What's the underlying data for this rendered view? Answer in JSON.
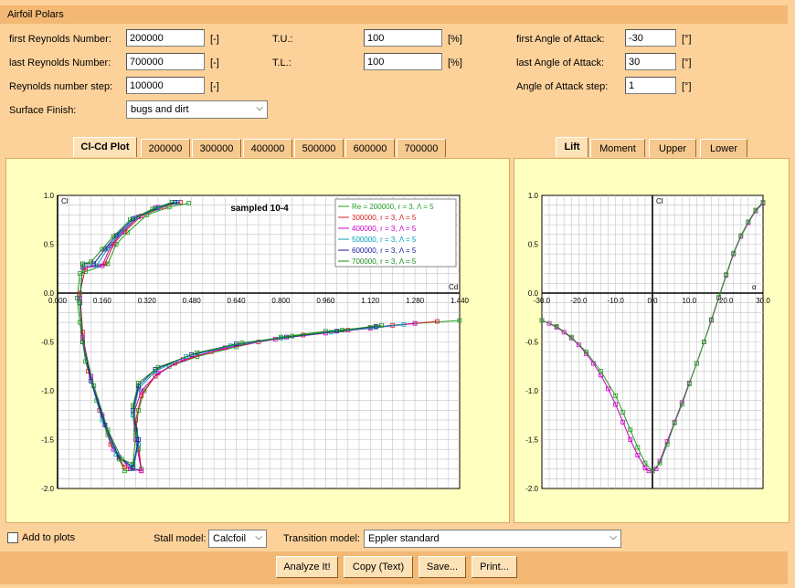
{
  "window": {
    "title": "Airfoil Polars"
  },
  "form": {
    "first_re": {
      "label": "first Reynolds Number:",
      "value": "200000",
      "unit": "[-]"
    },
    "last_re": {
      "label": "last Reynolds Number:",
      "value": "700000",
      "unit": "[-]"
    },
    "re_step": {
      "label": "Reynolds number step:",
      "value": "100000",
      "unit": "[-]"
    },
    "surface": {
      "label": "Surface Finish:",
      "value": "bugs and dirt"
    },
    "tu": {
      "label": "T.U.:",
      "value": "100",
      "unit": "[%]"
    },
    "tl": {
      "label": "T.L.:",
      "value": "100",
      "unit": "[%]"
    },
    "first_aoa": {
      "label": "first Angle of Attack:",
      "value": "-30",
      "unit": "[°]"
    },
    "last_aoa": {
      "label": "last Angle of Attack:",
      "value": "30",
      "unit": "[°]"
    },
    "aoa_step": {
      "label": "Angle of Attack step:",
      "value": "1",
      "unit": "[°]"
    }
  },
  "left_tabs": [
    "Cl-Cd Plot",
    "200000",
    "300000",
    "400000",
    "500000",
    "600000",
    "700000"
  ],
  "right_tabs": [
    "Lift",
    "Moment",
    "Upper",
    "Lower"
  ],
  "chart_data": [
    {
      "type": "line",
      "title": "sampled 10-4",
      "xlabel": "Cd",
      "ylabel": "Cl",
      "xlim": [
        0.0,
        1.44
      ],
      "ylim": [
        -2.0,
        1.0
      ],
      "x_ticks": [
        "0.000",
        "0.160",
        "0.320",
        "0.480",
        "0.640",
        "0.800",
        "0.960",
        "1.120",
        "1.280",
        "1.440"
      ],
      "y_ticks": [
        "1.0",
        "0.5",
        "0.0",
        "-0.5",
        "-1.0",
        "-1.5",
        "-2.0"
      ],
      "legend_position": "top-right",
      "series": [
        {
          "name": "Re = 200000, r = 3, Λ = 5",
          "color": "#1f9d1f",
          "points": [
            [
              0.47,
              0.92
            ],
            [
              0.4,
              0.88
            ],
            [
              0.32,
              0.8
            ],
            [
              0.25,
              0.62
            ],
            [
              0.21,
              0.5
            ],
            [
              0.18,
              0.3
            ],
            [
              0.1,
              0.22
            ],
            [
              0.08,
              0.2
            ],
            [
              0.07,
              -0.05
            ],
            [
              0.08,
              -0.3
            ],
            [
              0.1,
              -0.7
            ],
            [
              0.14,
              -1.1
            ],
            [
              0.18,
              -1.45
            ],
            [
              0.22,
              -1.7
            ],
            [
              0.24,
              -1.82
            ],
            [
              0.3,
              -1.8
            ],
            [
              0.29,
              -1.6
            ],
            [
              0.28,
              -1.4
            ],
            [
              0.29,
              -1.2
            ],
            [
              0.31,
              -1.0
            ],
            [
              0.35,
              -0.85
            ],
            [
              0.4,
              -0.75
            ],
            [
              0.5,
              -0.65
            ],
            [
              0.64,
              -0.55
            ],
            [
              0.8,
              -0.45
            ],
            [
              0.96,
              -0.39
            ],
            [
              1.12,
              -0.35
            ],
            [
              1.28,
              -0.31
            ],
            [
              1.44,
              -0.28
            ]
          ]
        },
        {
          "name": "300000, r = 3, Λ = 5",
          "color": "#d42020",
          "points": [
            [
              0.44,
              0.93
            ],
            [
              0.38,
              0.88
            ],
            [
              0.3,
              0.79
            ],
            [
              0.24,
              0.63
            ],
            [
              0.2,
              0.5
            ],
            [
              0.17,
              0.3
            ],
            [
              0.1,
              0.26
            ],
            [
              0.08,
              0.0
            ],
            [
              0.09,
              -0.4
            ],
            [
              0.11,
              -0.8
            ],
            [
              0.15,
              -1.2
            ],
            [
              0.19,
              -1.55
            ],
            [
              0.24,
              -1.78
            ],
            [
              0.3,
              -1.82
            ],
            [
              0.29,
              -1.55
            ],
            [
              0.28,
              -1.3
            ],
            [
              0.3,
              -1.05
            ],
            [
              0.35,
              -0.85
            ],
            [
              0.42,
              -0.72
            ],
            [
              0.55,
              -0.6
            ],
            [
              0.72,
              -0.5
            ],
            [
              0.88,
              -0.43
            ],
            [
              1.04,
              -0.38
            ],
            [
              1.2,
              -0.33
            ],
            [
              1.36,
              -0.29
            ]
          ]
        },
        {
          "name": "400000, r = 3, Λ = 5",
          "color": "#c800c8",
          "points": [
            [
              0.43,
              0.93
            ],
            [
              0.36,
              0.88
            ],
            [
              0.29,
              0.78
            ],
            [
              0.23,
              0.62
            ],
            [
              0.19,
              0.48
            ],
            [
              0.16,
              0.28
            ],
            [
              0.09,
              0.26
            ],
            [
              0.08,
              -0.05
            ],
            [
              0.09,
              -0.45
            ],
            [
              0.12,
              -0.85
            ],
            [
              0.16,
              -1.25
            ],
            [
              0.2,
              -1.6
            ],
            [
              0.26,
              -1.8
            ],
            [
              0.3,
              -1.82
            ],
            [
              0.28,
              -1.5
            ],
            [
              0.27,
              -1.25
            ],
            [
              0.3,
              -1.0
            ],
            [
              0.36,
              -0.82
            ],
            [
              0.45,
              -0.68
            ],
            [
              0.6,
              -0.56
            ],
            [
              0.78,
              -0.47
            ],
            [
              0.96,
              -0.41
            ],
            [
              1.12,
              -0.36
            ],
            [
              1.28,
              -0.31
            ]
          ]
        },
        {
          "name": "500000, r = 3, Λ = 5",
          "color": "#00a0b0",
          "points": [
            [
              0.43,
              0.93
            ],
            [
              0.36,
              0.87
            ],
            [
              0.28,
              0.77
            ],
            [
              0.22,
              0.6
            ],
            [
              0.18,
              0.46
            ],
            [
              0.14,
              0.28
            ],
            [
              0.09,
              0.28
            ],
            [
              0.08,
              -0.1
            ],
            [
              0.09,
              -0.5
            ],
            [
              0.12,
              -0.9
            ],
            [
              0.16,
              -1.3
            ],
            [
              0.21,
              -1.65
            ],
            [
              0.27,
              -1.8
            ],
            [
              0.29,
              -1.55
            ],
            [
              0.27,
              -1.25
            ],
            [
              0.29,
              -0.98
            ],
            [
              0.35,
              -0.8
            ],
            [
              0.46,
              -0.65
            ],
            [
              0.62,
              -0.54
            ],
            [
              0.8,
              -0.46
            ],
            [
              0.98,
              -0.4
            ],
            [
              1.14,
              -0.35
            ],
            [
              1.24,
              -0.32
            ]
          ]
        },
        {
          "name": "600000, r = 3, Λ = 5",
          "color": "#1a1aa0",
          "points": [
            [
              0.42,
              0.93
            ],
            [
              0.35,
              0.87
            ],
            [
              0.27,
              0.76
            ],
            [
              0.21,
              0.59
            ],
            [
              0.17,
              0.45
            ],
            [
              0.13,
              0.3
            ],
            [
              0.09,
              0.3
            ],
            [
              0.08,
              -0.1
            ],
            [
              0.09,
              -0.5
            ],
            [
              0.12,
              -0.9
            ],
            [
              0.17,
              -1.35
            ],
            [
              0.22,
              -1.68
            ],
            [
              0.27,
              -1.78
            ],
            [
              0.29,
              -1.5
            ],
            [
              0.27,
              -1.2
            ],
            [
              0.29,
              -0.95
            ],
            [
              0.35,
              -0.78
            ],
            [
              0.48,
              -0.63
            ],
            [
              0.64,
              -0.52
            ],
            [
              0.82,
              -0.45
            ],
            [
              1.0,
              -0.39
            ],
            [
              1.14,
              -0.34
            ]
          ]
        },
        {
          "name": "700000, r = 3, Λ = 5",
          "color": "#1a8a1a",
          "points": [
            [
              0.41,
              0.93
            ],
            [
              0.34,
              0.86
            ],
            [
              0.26,
              0.75
            ],
            [
              0.2,
              0.58
            ],
            [
              0.16,
              0.45
            ],
            [
              0.12,
              0.32
            ],
            [
              0.09,
              0.3
            ],
            [
              0.08,
              -0.1
            ],
            [
              0.09,
              -0.5
            ],
            [
              0.13,
              -0.95
            ],
            [
              0.18,
              -1.4
            ],
            [
              0.23,
              -1.7
            ],
            [
              0.27,
              -1.75
            ],
            [
              0.28,
              -1.45
            ],
            [
              0.27,
              -1.15
            ],
            [
              0.29,
              -0.92
            ],
            [
              0.36,
              -0.76
            ],
            [
              0.5,
              -0.61
            ],
            [
              0.66,
              -0.51
            ],
            [
              0.84,
              -0.44
            ],
            [
              1.02,
              -0.38
            ],
            [
              1.16,
              -0.33
            ]
          ]
        }
      ]
    },
    {
      "type": "line",
      "xlabel": "α",
      "ylabel": "Cl",
      "xlim": [
        -30,
        30
      ],
      "ylim": [
        -2.0,
        1.0
      ],
      "x_ticks": [
        "-30.0",
        "-20.0",
        "-10.0",
        "0.0",
        "10.0",
        "20.0",
        "30.0"
      ],
      "y_ticks": [
        "1.0",
        "0.5",
        "0.0",
        "-0.5",
        "-1.0",
        "-1.5",
        "-2.0"
      ],
      "series": [
        {
          "color": "#c800c8",
          "points": [
            [
              -30,
              -0.28
            ],
            [
              -28,
              -0.31
            ],
            [
              -26,
              -0.35
            ],
            [
              -24,
              -0.4
            ],
            [
              -22,
              -0.46
            ],
            [
              -20,
              -0.53
            ],
            [
              -18,
              -0.62
            ],
            [
              -16,
              -0.72
            ],
            [
              -14,
              -0.84
            ],
            [
              -12,
              -0.98
            ],
            [
              -10,
              -1.14
            ],
            [
              -8,
              -1.32
            ],
            [
              -6,
              -1.5
            ],
            [
              -4,
              -1.66
            ],
            [
              -2,
              -1.79
            ],
            [
              -1,
              -1.82
            ],
            [
              0,
              -1.82
            ],
            [
              1,
              -1.8
            ],
            [
              2,
              -1.72
            ],
            [
              4,
              -1.52
            ],
            [
              6,
              -1.32
            ],
            [
              8,
              -1.12
            ],
            [
              10,
              -0.92
            ],
            [
              12,
              -0.72
            ],
            [
              14,
              -0.5
            ],
            [
              16,
              -0.28
            ],
            [
              18,
              -0.05
            ],
            [
              20,
              0.18
            ],
            [
              22,
              0.4
            ],
            [
              24,
              0.58
            ],
            [
              26,
              0.72
            ],
            [
              28,
              0.84
            ],
            [
              30,
              0.92
            ]
          ]
        },
        {
          "color": "#1f9d1f",
          "points": [
            [
              -30,
              -0.28
            ],
            [
              -26,
              -0.34
            ],
            [
              -22,
              -0.45
            ],
            [
              -18,
              -0.6
            ],
            [
              -14,
              -0.8
            ],
            [
              -10,
              -1.05
            ],
            [
              -8,
              -1.22
            ],
            [
              -6,
              -1.4
            ],
            [
              -4,
              -1.58
            ],
            [
              -2,
              -1.74
            ],
            [
              0,
              -1.82
            ],
            [
              2,
              -1.74
            ],
            [
              4,
              -1.55
            ],
            [
              6,
              -1.33
            ],
            [
              8,
              -1.14
            ],
            [
              10,
              -0.93
            ],
            [
              12,
              -0.72
            ],
            [
              14,
              -0.5
            ],
            [
              16,
              -0.27
            ],
            [
              18,
              -0.04
            ],
            [
              20,
              0.19
            ],
            [
              22,
              0.41
            ],
            [
              24,
              0.59
            ],
            [
              26,
              0.73
            ],
            [
              28,
              0.85
            ],
            [
              30,
              0.93
            ]
          ]
        }
      ]
    }
  ],
  "bottom": {
    "add_to_plots": "Add to plots",
    "stall_label": "Stall model:",
    "stall_value": "Calcfoil",
    "transition_label": "Transition model:",
    "transition_value": "Eppler standard"
  },
  "buttons": {
    "analyze": "Analyze It!",
    "copy": "Copy (Text)",
    "save": "Save...",
    "print": "Print..."
  }
}
